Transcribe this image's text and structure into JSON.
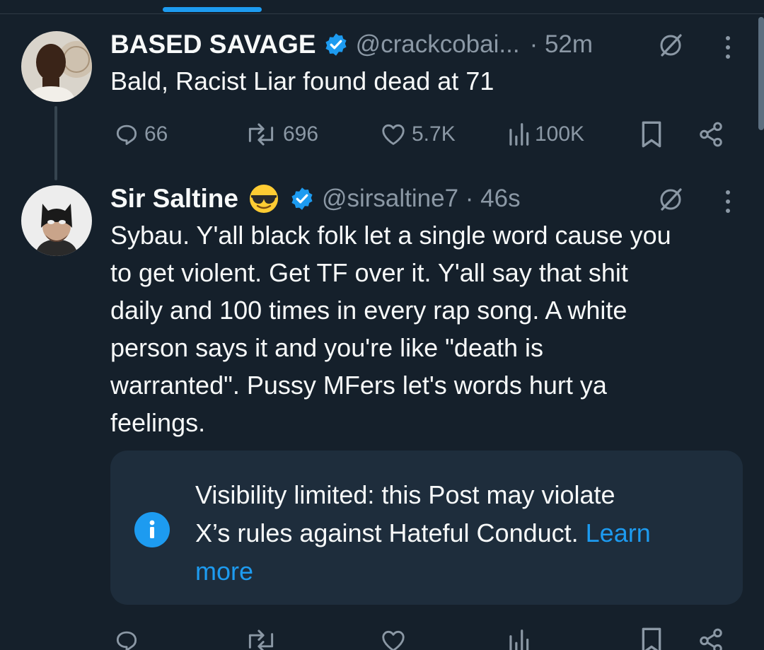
{
  "tweets": [
    {
      "name": "BASED SAVAGE",
      "handle": "@crackcobai...",
      "time": "· 52m",
      "text": "Bald, Racist Liar found dead at 71",
      "stats": {
        "replies": "66",
        "reposts": "696",
        "likes": "5.7K",
        "views": "100K"
      }
    },
    {
      "name": "Sir Saltine",
      "handle": "@sirsaltine7 · 46s",
      "emoji": "sunglasses-emoji",
      "text_lines": [
        "Sybau. Y'all black folk let a single word cause you",
        "to get violent. Get TF over it. Y'all say that shit",
        "daily and 100 times in every rap song. A white",
        "person says it and you're like \"death is",
        "warranted\". Pussy MFers let's words hurt ya",
        "feelings."
      ],
      "notice": {
        "line1": "Visibility limited: this Post may violate",
        "line2": "X’s rules against Hateful Conduct.",
        "learn_1": "Learn",
        "learn_2": "more"
      }
    }
  ],
  "colors": {
    "background": "#15202b",
    "accent": "#1d9bf0",
    "secondary_text": "#8b98a5",
    "notice_bg": "#1e2d3c"
  },
  "icons": [
    "verified-badge-icon",
    "grok-icon",
    "more-icon",
    "reply-icon",
    "repost-icon",
    "like-icon",
    "views-icon",
    "bookmark-icon",
    "share-icon",
    "info-icon"
  ]
}
